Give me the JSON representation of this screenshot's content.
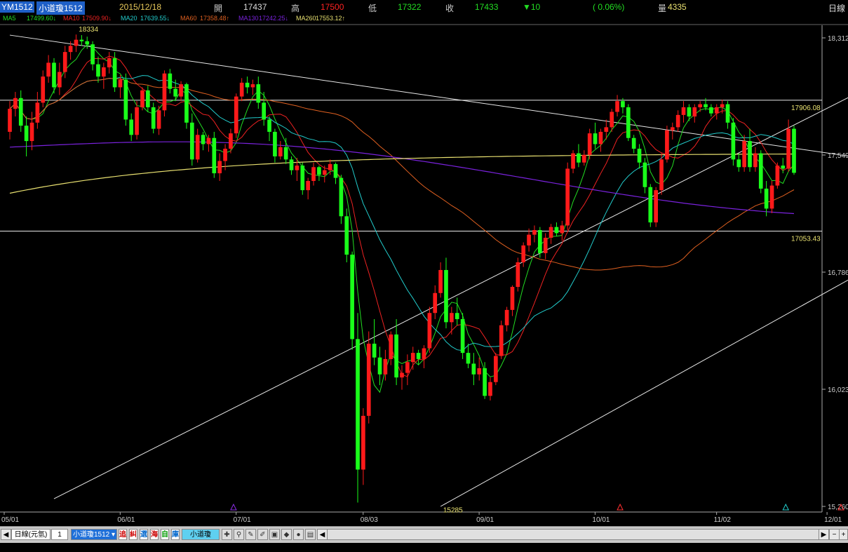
{
  "header": {
    "symbol": "YM1512",
    "name": "小道瓊1512",
    "date": "2015/12/18",
    "open_label": "開",
    "open": "17437",
    "high_label": "高",
    "high": "17500",
    "low_label": "低",
    "low": "17322",
    "close_label": "收",
    "close": "17433",
    "change": "▼10",
    "change_pct": "( 0.06%)",
    "volume_label": "量",
    "volume": "4335",
    "period": "日線"
  },
  "ma": [
    {
      "label": "MA5",
      "value": "17499.60↓",
      "color": "#22dd22"
    },
    {
      "label": "MA10",
      "value": "17509.90↓",
      "color": "#ee2222"
    },
    {
      "label": "MA20",
      "value": "17639.55↓",
      "color": "#22cccc"
    },
    {
      "label": "MA60",
      "value": "17358.48↑",
      "color": "#e06020"
    },
    {
      "label": "MA130",
      "value": "17242.25↓",
      "color": "#7a22dd"
    },
    {
      "label": "MA260",
      "value": "17553.12↑",
      "color": "#e8e070"
    }
  ],
  "chart_data": {
    "type": "candlestick",
    "y_ticks": [
      "18,312",
      "17,549",
      "16,786",
      "16,023",
      "15,260"
    ],
    "ylim": [
      15260,
      18312
    ],
    "x_ticks": [
      {
        "label": "05/01",
        "i": 0
      },
      {
        "label": "06/01",
        "i": 21
      },
      {
        "label": "07/01",
        "i": 42
      },
      {
        "label": "08/03",
        "i": 65
      },
      {
        "label": "09/01",
        "i": 86
      },
      {
        "label": "10/01",
        "i": 107
      },
      {
        "label": "12/01",
        "i": 149
      },
      {
        "label": "11/02",
        "i": 129
      }
    ],
    "annotations": [
      {
        "text": "18334",
        "i": 14,
        "value": 18334
      },
      {
        "text": "15285",
        "i": 80,
        "value": 15285
      },
      {
        "text": "17906.08",
        "value": 17906.08
      },
      {
        "text": "17053.43",
        "value": 17053.43
      }
    ],
    "hlines": [
      17906.08,
      17053.43
    ],
    "trendlines": [
      {
        "from": {
          "i": 0,
          "v": 18330
        },
        "to": {
          "i": 167,
          "v": 17435
        }
      },
      {
        "from": {
          "i": 8,
          "v": 15310
        },
        "to": {
          "i": 167,
          "v": 18300
        }
      },
      {
        "from": {
          "i": 78,
          "v": 15260
        },
        "to": {
          "i": 167,
          "v": 17150
        }
      }
    ],
    "candles": [
      [
        17700,
        17900,
        17650,
        17850
      ],
      [
        17850,
        17960,
        17800,
        17920
      ],
      [
        17920,
        17970,
        17700,
        17740
      ],
      [
        17740,
        17800,
        17540,
        17640
      ],
      [
        17640,
        17830,
        17580,
        17760
      ],
      [
        17760,
        17960,
        17720,
        17890
      ],
      [
        17890,
        18100,
        17860,
        18060
      ],
      [
        18060,
        18200,
        18020,
        18150
      ],
      [
        18150,
        18180,
        17950,
        17990
      ],
      [
        17990,
        18150,
        17940,
        18090
      ],
      [
        18090,
        18260,
        18050,
        18220
      ],
      [
        18220,
        18290,
        18170,
        18260
      ],
      [
        18260,
        18334,
        18220,
        18300
      ],
      [
        18300,
        18330,
        18260,
        18290
      ],
      [
        18290,
        18320,
        18240,
        18270
      ],
      [
        18270,
        18290,
        18100,
        18140
      ],
      [
        18140,
        18190,
        18020,
        18060
      ],
      [
        18060,
        18150,
        17980,
        18120
      ],
      [
        18120,
        18220,
        18080,
        18180
      ],
      [
        18180,
        18220,
        17960,
        17990
      ],
      [
        17990,
        18070,
        17920,
        18040
      ],
      [
        18040,
        18080,
        17740,
        17780
      ],
      [
        17780,
        17820,
        17640,
        17680
      ],
      [
        17680,
        17900,
        17650,
        17860
      ],
      [
        17860,
        17990,
        17840,
        17970
      ],
      [
        17970,
        18000,
        17830,
        17860
      ],
      [
        17860,
        17890,
        17690,
        17720
      ],
      [
        17720,
        17870,
        17680,
        17840
      ],
      [
        17840,
        18100,
        17800,
        18080
      ],
      [
        18080,
        18110,
        17950,
        17980
      ],
      [
        17980,
        18040,
        17900,
        17930
      ],
      [
        17930,
        18030,
        17900,
        18010
      ],
      [
        18010,
        18020,
        17720,
        17760
      ],
      [
        17760,
        17820,
        17480,
        17520
      ],
      [
        17520,
        17720,
        17500,
        17680
      ],
      [
        17680,
        17700,
        17580,
        17620
      ],
      [
        17620,
        17680,
        17570,
        17660
      ],
      [
        17660,
        17700,
        17400,
        17430
      ],
      [
        17430,
        17560,
        17380,
        17510
      ],
      [
        17510,
        17620,
        17450,
        17590
      ],
      [
        17590,
        17720,
        17560,
        17690
      ],
      [
        17690,
        17950,
        17660,
        17930
      ],
      [
        17930,
        18050,
        17900,
        18020
      ],
      [
        18020,
        18060,
        17950,
        17990
      ],
      [
        17990,
        18040,
        17940,
        18010
      ],
      [
        18010,
        18060,
        17850,
        17890
      ],
      [
        17890,
        17960,
        17740,
        17780
      ],
      [
        17780,
        17800,
        17640,
        17700
      ],
      [
        17700,
        17720,
        17500,
        17540
      ],
      [
        17540,
        17640,
        17520,
        17600
      ],
      [
        17600,
        17660,
        17490,
        17520
      ],
      [
        17520,
        17540,
        17420,
        17450
      ],
      [
        17450,
        17530,
        17380,
        17480
      ],
      [
        17480,
        17500,
        17290,
        17320
      ],
      [
        17320,
        17400,
        17260,
        17380
      ],
      [
        17380,
        17500,
        17350,
        17470
      ],
      [
        17470,
        17480,
        17380,
        17420
      ],
      [
        17420,
        17480,
        17370,
        17450
      ],
      [
        17450,
        17520,
        17420,
        17490
      ],
      [
        17490,
        17500,
        17360,
        17400
      ],
      [
        17400,
        17420,
        17100,
        17150
      ],
      [
        17150,
        17200,
        16850,
        16900
      ],
      [
        16900,
        16920,
        16280,
        16350
      ],
      [
        16350,
        16520,
        15285,
        15500
      ],
      [
        15500,
        15900,
        15400,
        15850
      ],
      [
        15850,
        16400,
        15800,
        16320
      ],
      [
        16320,
        16480,
        16180,
        16230
      ],
      [
        16230,
        16300,
        16050,
        16120
      ],
      [
        16120,
        16280,
        16080,
        16220
      ],
      [
        16220,
        16400,
        16180,
        16380
      ],
      [
        16380,
        16480,
        16050,
        16100
      ],
      [
        16100,
        16180,
        16020,
        16130
      ],
      [
        16130,
        16250,
        16050,
        16200
      ],
      [
        16200,
        16300,
        16150,
        16260
      ],
      [
        16260,
        16280,
        16180,
        16220
      ],
      [
        16220,
        16310,
        16160,
        16290
      ],
      [
        16290,
        16560,
        16260,
        16520
      ],
      [
        16520,
        16700,
        16480,
        16650
      ],
      [
        16650,
        16850,
        16620,
        16800
      ],
      [
        16800,
        16880,
        16420,
        16460
      ],
      [
        16460,
        16560,
        16380,
        16520
      ],
      [
        16520,
        16620,
        16440,
        16480
      ],
      [
        16480,
        16520,
        16220,
        16260
      ],
      [
        16260,
        16320,
        16160,
        16190
      ],
      [
        16190,
        16260,
        16050,
        16120
      ],
      [
        16120,
        16230,
        16080,
        16160
      ],
      [
        16160,
        16200,
        15960,
        15980
      ],
      [
        15980,
        16100,
        15950,
        16070
      ],
      [
        16070,
        16260,
        16050,
        16240
      ],
      [
        16240,
        16470,
        16220,
        16440
      ],
      [
        16440,
        16560,
        16400,
        16540
      ],
      [
        16540,
        16700,
        16500,
        16690
      ],
      [
        16690,
        16880,
        16660,
        16850
      ],
      [
        16850,
        16980,
        16820,
        16960
      ],
      [
        16960,
        17070,
        16920,
        17030
      ],
      [
        17030,
        17090,
        16980,
        17060
      ],
      [
        17060,
        17080,
        16880,
        16910
      ],
      [
        16910,
        17040,
        16870,
        17010
      ],
      [
        17010,
        17100,
        16970,
        17080
      ],
      [
        17080,
        17110,
        17020,
        17040
      ],
      [
        17040,
        17120,
        16990,
        17090
      ],
      [
        17090,
        17500,
        17060,
        17460
      ],
      [
        17460,
        17580,
        17430,
        17560
      ],
      [
        17560,
        17620,
        17470,
        17500
      ],
      [
        17500,
        17580,
        17480,
        17550
      ],
      [
        17550,
        17720,
        17520,
        17690
      ],
      [
        17690,
        17760,
        17590,
        17620
      ],
      [
        17620,
        17720,
        17570,
        17700
      ],
      [
        17700,
        17780,
        17650,
        17730
      ],
      [
        17730,
        17850,
        17700,
        17830
      ],
      [
        17830,
        17940,
        17800,
        17900
      ],
      [
        17900,
        17920,
        17820,
        17860
      ],
      [
        17860,
        17880,
        17640,
        17660
      ],
      [
        17660,
        17680,
        17560,
        17590
      ],
      [
        17590,
        17620,
        17460,
        17500
      ],
      [
        17500,
        17530,
        17300,
        17340
      ],
      [
        17340,
        17360,
        17080,
        17110
      ],
      [
        17110,
        17340,
        17080,
        17320
      ],
      [
        17320,
        17560,
        17290,
        17520
      ],
      [
        17520,
        17740,
        17500,
        17710
      ],
      [
        17710,
        17760,
        17650,
        17730
      ],
      [
        17730,
        17840,
        17700,
        17810
      ],
      [
        17810,
        17900,
        17760,
        17860
      ],
      [
        17860,
        17880,
        17770,
        17800
      ],
      [
        17800,
        17880,
        17760,
        17860
      ],
      [
        17860,
        17900,
        17830,
        17880
      ],
      [
        17880,
        17920,
        17840,
        17860
      ],
      [
        17860,
        17880,
        17800,
        17820
      ],
      [
        17820,
        17880,
        17780,
        17860
      ],
      [
        17860,
        17910,
        17820,
        17880
      ],
      [
        17880,
        17900,
        17720,
        17760
      ],
      [
        17760,
        17790,
        17480,
        17520
      ],
      [
        17520,
        17560,
        17440,
        17470
      ],
      [
        17470,
        17680,
        17440,
        17640
      ],
      [
        17640,
        17720,
        17440,
        17470
      ],
      [
        17470,
        17600,
        17440,
        17560
      ],
      [
        17560,
        17580,
        17300,
        17330
      ],
      [
        17330,
        17380,
        17150,
        17200
      ],
      [
        17200,
        17380,
        17170,
        17350
      ],
      [
        17350,
        17500,
        17330,
        17480
      ],
      [
        17480,
        17530,
        17430,
        17460
      ],
      [
        17460,
        17780,
        17440,
        17720
      ],
      [
        17720,
        17740,
        17420,
        17433
      ]
    ],
    "colors": {
      "up": "#ff1a1a",
      "down": "#1aff1a"
    },
    "bottom_markers": [
      {
        "i": 40,
        "color": "#8a2be2"
      },
      {
        "i": 110,
        "color": "#ff3030"
      },
      {
        "i": 140,
        "color": "#22cccc"
      },
      {
        "i": 150,
        "color": "#ff3030"
      },
      {
        "i": 155,
        "color": "#22dd22"
      }
    ]
  },
  "toolbar": {
    "period_select": "日線(元氫)",
    "count": "1",
    "symbol_select": "小道瓊1512",
    "tabs": [
      "追",
      "糾",
      "選",
      "海",
      "自",
      "庫"
    ],
    "label": "小道瓊1512",
    "icons": [
      "crosshair-icon",
      "zoom-icon",
      "pencil-icon",
      "square-icon",
      "diamond-icon",
      "droplet-icon",
      "printer-icon",
      "square-icon"
    ]
  }
}
